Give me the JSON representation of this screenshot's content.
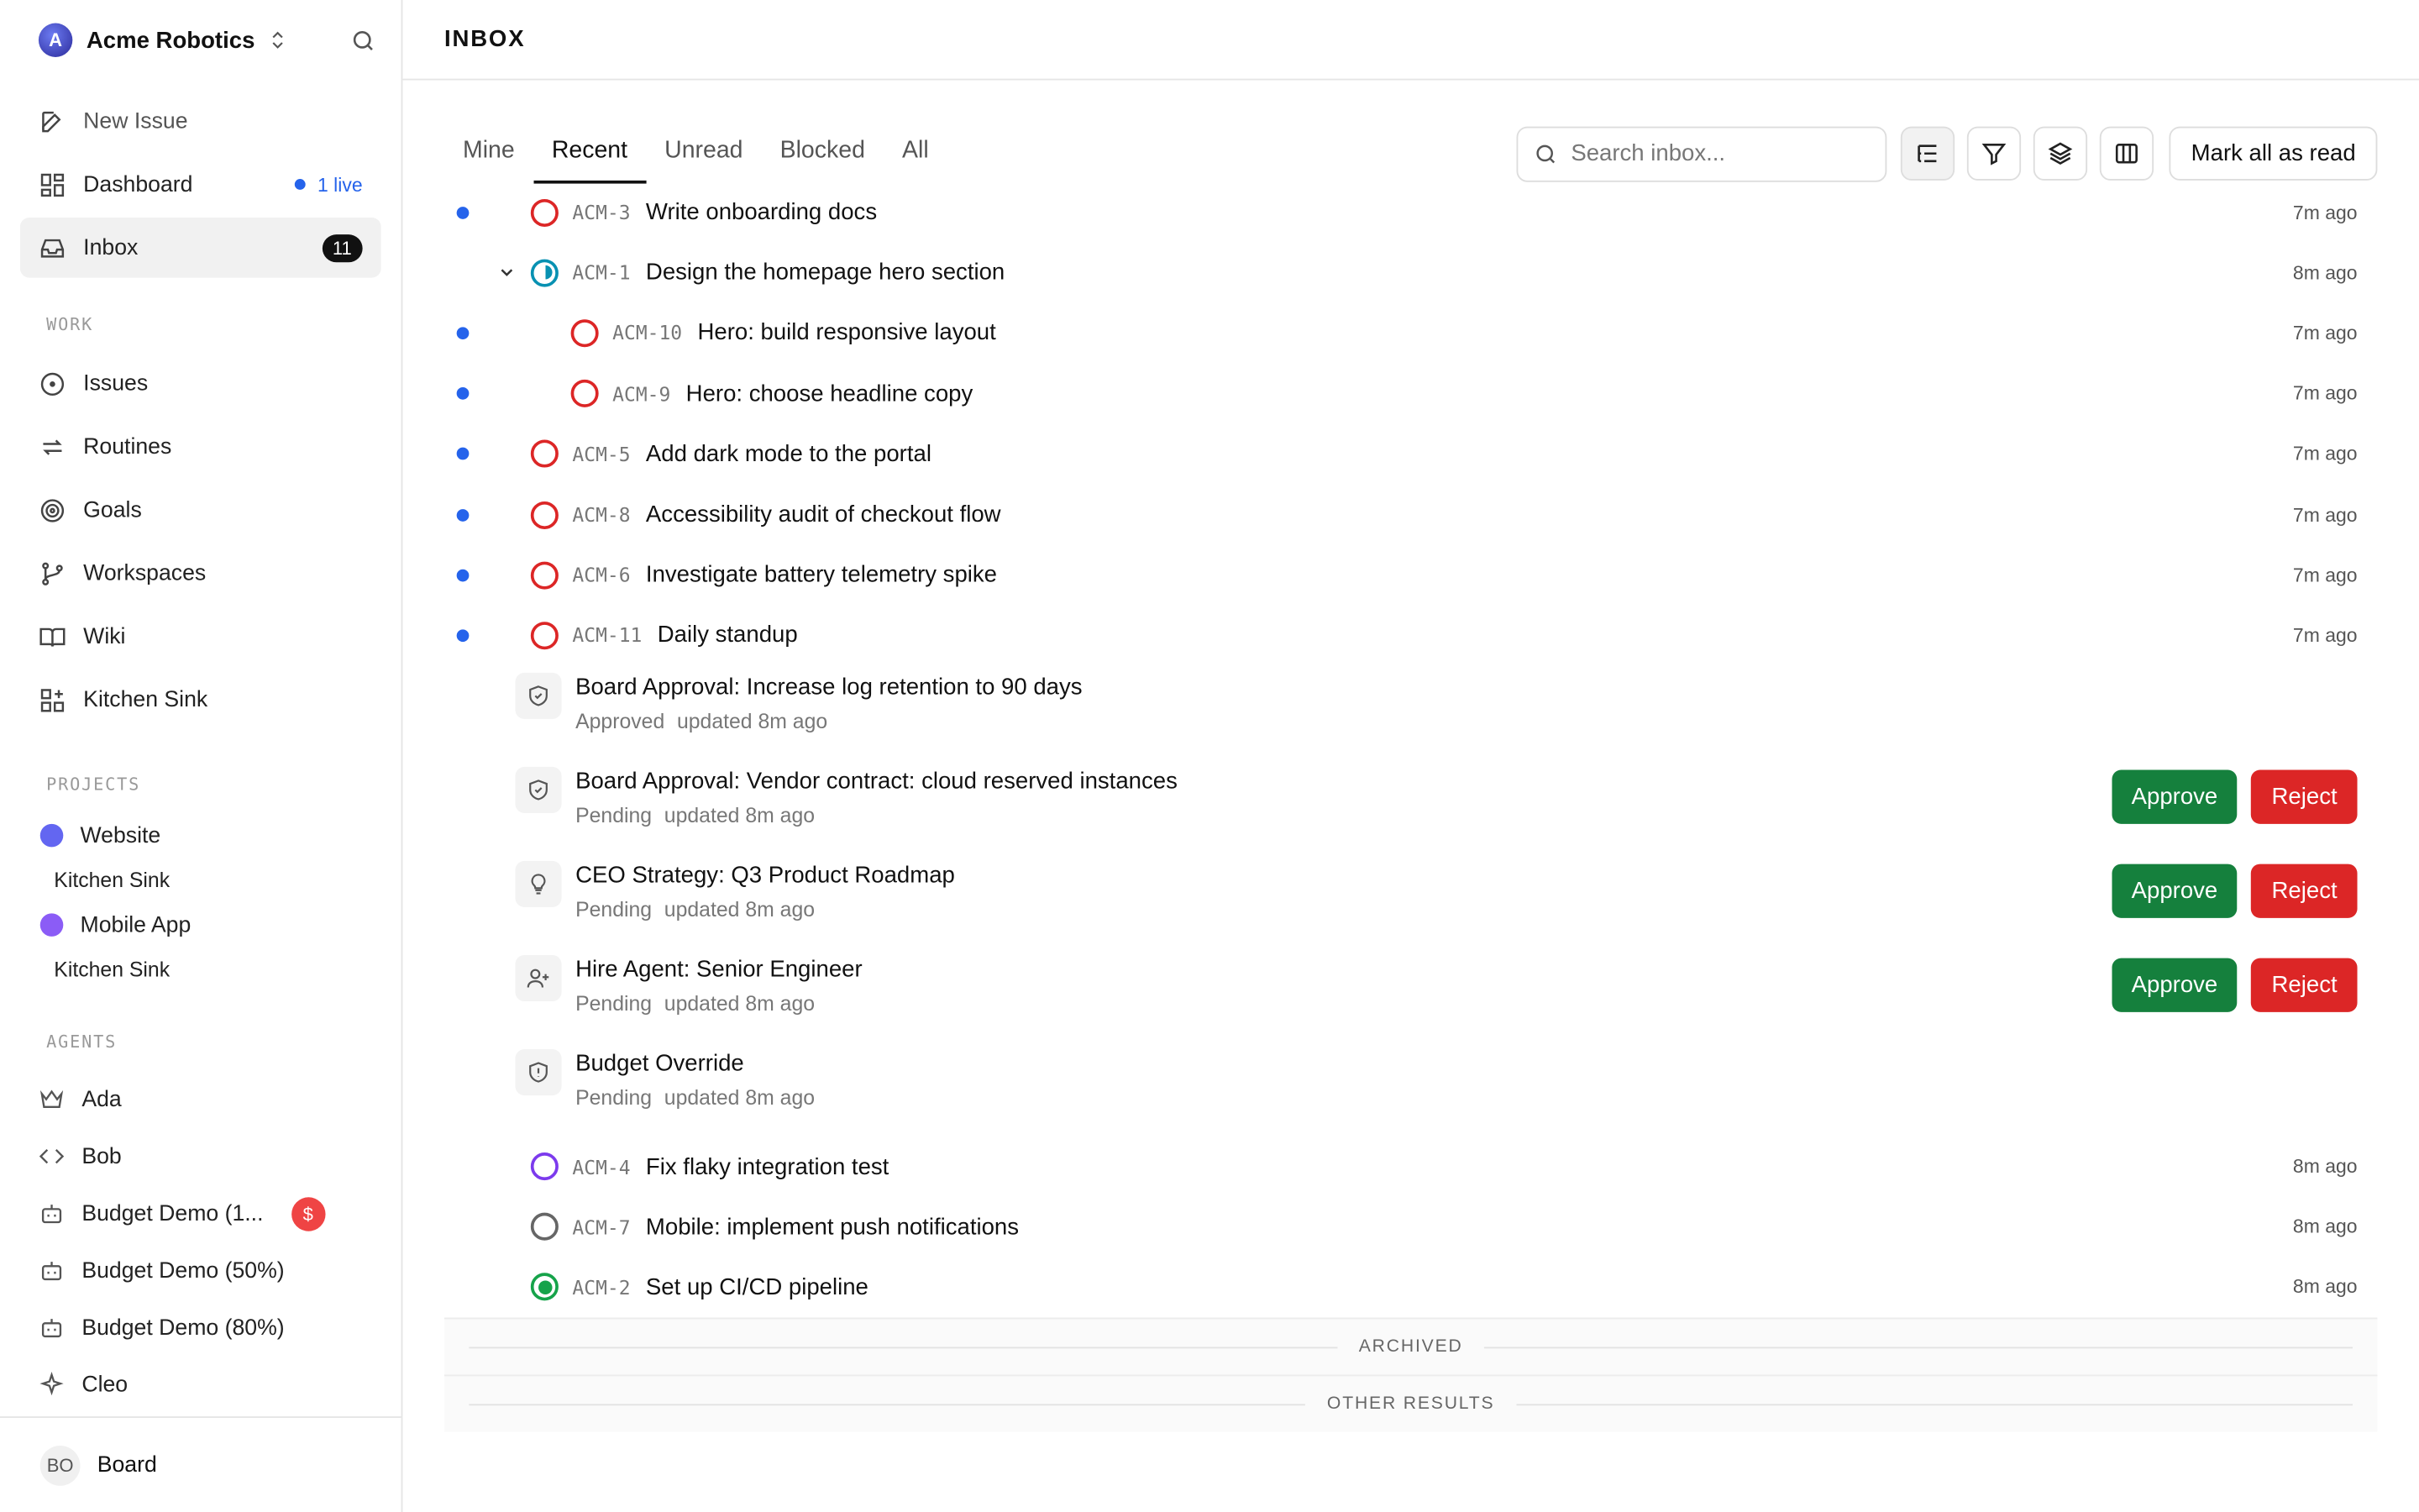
{
  "workspace": {
    "initial": "A",
    "name": "Acme Robotics"
  },
  "nav": {
    "new_issue": "New Issue",
    "dashboard": "Dashboard",
    "dashboard_live": "1 live",
    "inbox": "Inbox",
    "inbox_count": "11"
  },
  "sections": {
    "work": "WORK",
    "projects": "PROJECTS",
    "agents": "AGENTS"
  },
  "work_items": [
    "Issues",
    "Routines",
    "Goals",
    "Workspaces",
    "Wiki",
    "Kitchen Sink"
  ],
  "projects": [
    {
      "name": "Website",
      "color": "#6366f1",
      "sub": "Kitchen Sink"
    },
    {
      "name": "Mobile App",
      "color": "#8b5cf6",
      "sub": "Kitchen Sink"
    }
  ],
  "agents": [
    {
      "name": "Ada",
      "icon": "crown-icon"
    },
    {
      "name": "Bob",
      "icon": "code-icon"
    },
    {
      "name": "Budget Demo (1...",
      "icon": "bot-icon",
      "badge": "$"
    },
    {
      "name": "Budget Demo (50%)",
      "icon": "bot-icon"
    },
    {
      "name": "Budget Demo (80%)",
      "icon": "bot-icon"
    },
    {
      "name": "Cleo",
      "icon": "sparkle-icon"
    }
  ],
  "footer": {
    "initials": "BO",
    "name": "Board"
  },
  "header": {
    "title": "INBOX"
  },
  "tabs": [
    "Mine",
    "Recent",
    "Unread",
    "Blocked",
    "All"
  ],
  "active_tab": "Recent",
  "search": {
    "placeholder": "Search inbox..."
  },
  "mark_all_label": "Mark all as read",
  "issues_top": [
    {
      "key": "ACM-3",
      "title": "Write onboarding docs",
      "time": "7m ago",
      "unread": true,
      "status": "todo"
    },
    {
      "key": "ACM-1",
      "title": "Design the homepage hero section",
      "time": "8m ago",
      "unread": false,
      "status": "in_progress",
      "expanded": true
    },
    {
      "key": "ACM-10",
      "title": "Hero: build responsive layout",
      "time": "7m ago",
      "unread": true,
      "status": "todo",
      "child": true
    },
    {
      "key": "ACM-9",
      "title": "Hero: choose headline copy",
      "time": "7m ago",
      "unread": true,
      "status": "todo",
      "child": true
    },
    {
      "key": "ACM-5",
      "title": "Add dark mode to the portal",
      "time": "7m ago",
      "unread": true,
      "status": "todo"
    },
    {
      "key": "ACM-8",
      "title": "Accessibility audit of checkout flow",
      "time": "7m ago",
      "unread": true,
      "status": "todo"
    },
    {
      "key": "ACM-6",
      "title": "Investigate battery telemetry spike",
      "time": "7m ago",
      "unread": true,
      "status": "todo"
    },
    {
      "key": "ACM-11",
      "title": "Daily standup",
      "time": "7m ago",
      "unread": true,
      "status": "todo"
    }
  ],
  "approvals": [
    {
      "title": "Board Approval: Increase log retention to 90 days",
      "status": "Approved",
      "updated": "updated 8m ago",
      "icon": "shield-check-icon",
      "actions": false
    },
    {
      "title": "Board Approval: Vendor contract: cloud reserved instances",
      "status": "Pending",
      "updated": "updated 8m ago",
      "icon": "shield-check-icon",
      "actions": true
    },
    {
      "title": "CEO Strategy: Q3 Product Roadmap",
      "status": "Pending",
      "updated": "updated 8m ago",
      "icon": "lightbulb-icon",
      "actions": true
    },
    {
      "title": "Hire Agent: Senior Engineer",
      "status": "Pending",
      "updated": "updated 8m ago",
      "icon": "user-plus-icon",
      "actions": true
    },
    {
      "title": "Budget Override",
      "status": "Pending",
      "updated": "updated 8m ago",
      "icon": "shield-alert-icon",
      "actions": false
    }
  ],
  "approve_label": "Approve",
  "reject_label": "Reject",
  "issues_bottom": [
    {
      "key": "ACM-4",
      "title": "Fix flaky integration test",
      "time": "8m ago",
      "status": "todo_purple"
    },
    {
      "key": "ACM-7",
      "title": "Mobile: implement push notifications",
      "time": "8m ago",
      "status": "backlog"
    },
    {
      "key": "ACM-2",
      "title": "Set up CI/CD pipeline",
      "time": "8m ago",
      "status": "done"
    }
  ],
  "dividers": {
    "archived": "ARCHIVED",
    "other": "OTHER RESULTS"
  },
  "colors": {
    "accent": "#2563eb",
    "approve": "#15803d",
    "reject": "#dc2626"
  }
}
